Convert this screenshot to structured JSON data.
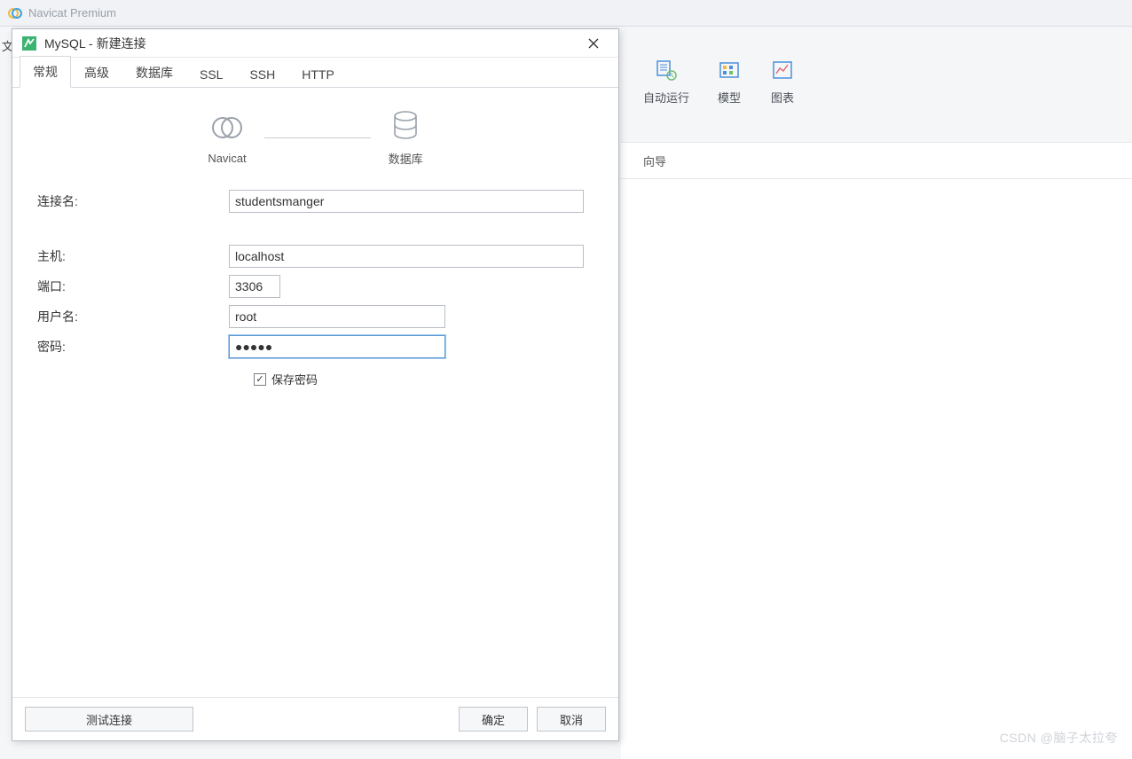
{
  "app": {
    "title": "Navicat Premium"
  },
  "bg_toolbar": {
    "items": [
      {
        "label": "自动运行"
      },
      {
        "label": "模型"
      },
      {
        "label": "图表"
      }
    ],
    "sub_hint": "向导"
  },
  "trunc_menu": "文",
  "dialog": {
    "title": "MySQL - 新建连接",
    "tabs": [
      "常规",
      "高级",
      "数据库",
      "SSL",
      "SSH",
      "HTTP"
    ],
    "active_tab": 0,
    "graphic": {
      "left_label": "Navicat",
      "right_label": "数据库"
    },
    "fields": {
      "conn_name_label": "连接名:",
      "conn_name_value": "studentsmanger",
      "host_label": "主机:",
      "host_value": "localhost",
      "port_label": "端口:",
      "port_value": "3306",
      "user_label": "用户名:",
      "user_value": "root",
      "password_label": "密码:",
      "password_value": "●●●●●",
      "save_password_label": "保存密码",
      "save_password_checked": true
    },
    "buttons": {
      "test": "测试连接",
      "ok": "确定",
      "cancel": "取消"
    }
  },
  "watermark": "CSDN @脑子太拉夸"
}
